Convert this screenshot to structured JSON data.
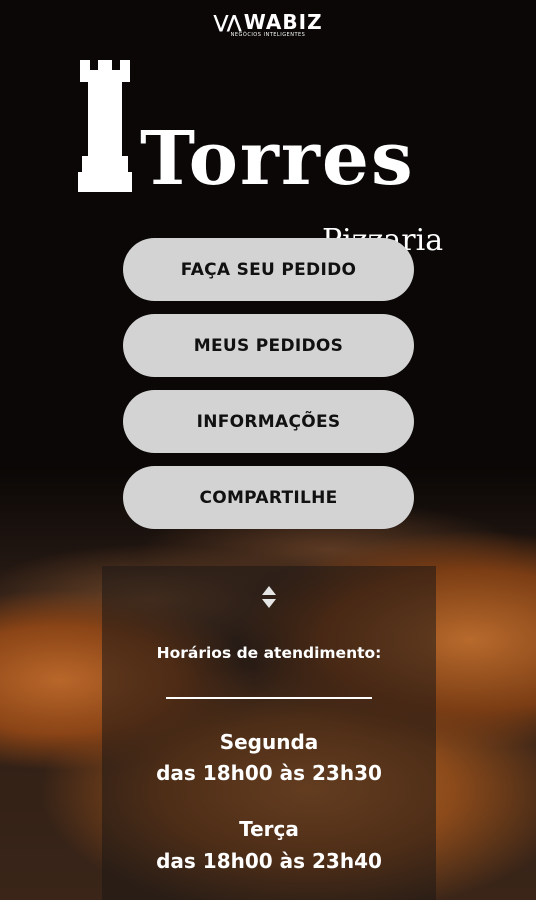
{
  "brand": {
    "mark": "⋁⋀",
    "name": "WABIZ",
    "tagline": "NEGÓCIOS INTELIGENTES"
  },
  "logo": {
    "title": "Torres",
    "subtitle": "Pizzaria"
  },
  "menu": [
    {
      "label": "FAÇA SEU PEDIDO"
    },
    {
      "label": "MEUS PEDIDOS"
    },
    {
      "label": "INFORMAÇÕES"
    },
    {
      "label": "COMPARTILHE"
    }
  ],
  "hours": {
    "title": "Horários de atendimento:",
    "entries": [
      {
        "day": "Segunda",
        "time": "das 18h00 às 23h30"
      },
      {
        "day": "Terça",
        "time": "das 18h00 às 23h40"
      }
    ]
  },
  "colors": {
    "button": "#d3d3d3",
    "text_dark": "#111111",
    "text_light": "#ffffff",
    "background": "#0b0807"
  }
}
